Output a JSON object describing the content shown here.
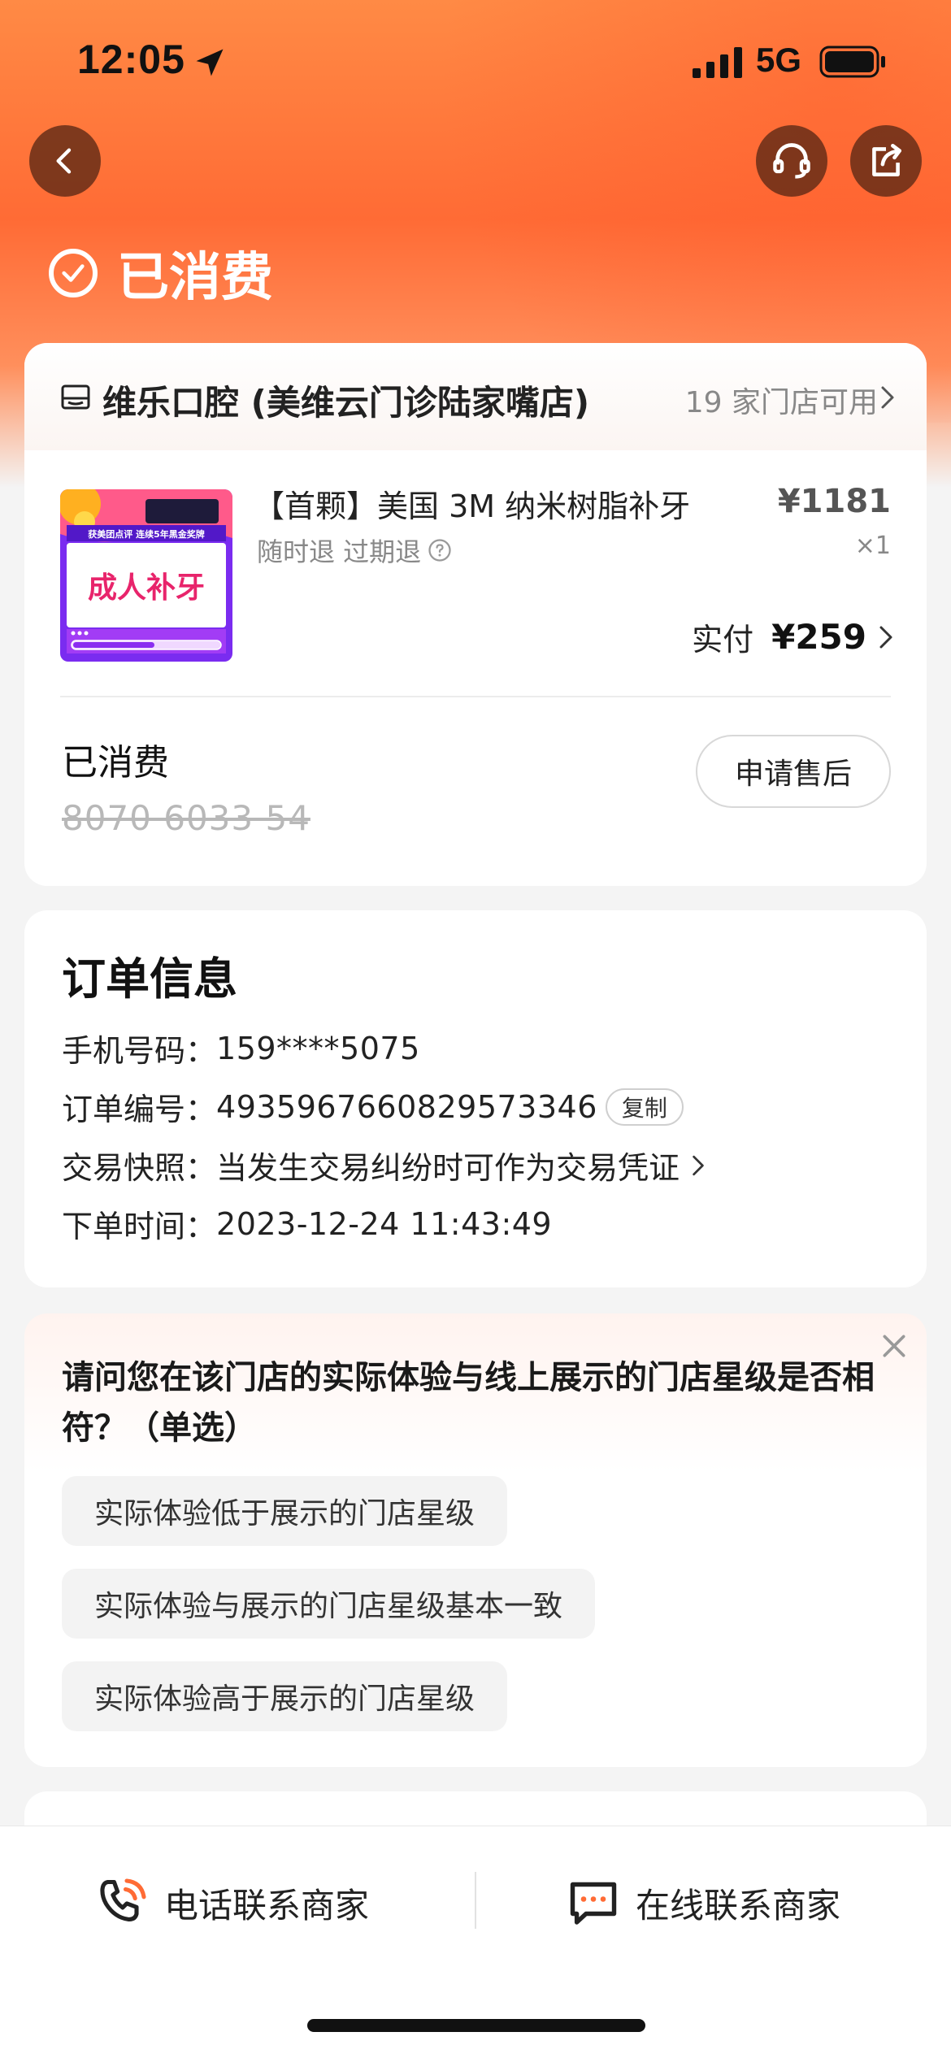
{
  "status_bar": {
    "time": "12:05",
    "network": "5G"
  },
  "header": {
    "order_status": "已消费"
  },
  "store": {
    "name": "维乐口腔 (美维云门诊陆家嘴店)",
    "available_count": "19 家门店可用"
  },
  "product": {
    "thumb_banner": "获美团点评 连续5年黑金奖牌",
    "thumb_title": "成人补牙",
    "title": "【首颗】美国 3M 纳米树脂补牙",
    "tags": "随时退 过期退",
    "price": "¥1181",
    "quantity": "×1",
    "paid_label": "实付",
    "paid_amount": "¥259"
  },
  "voucher": {
    "status": "已消费",
    "code": "8070 6033 54",
    "aftersale_label": "申请售后"
  },
  "order_info": {
    "title": "订单信息",
    "phone_label": "手机号码：",
    "phone": "159****5075",
    "order_no_label": "订单编号：",
    "order_no": "4935967660829573346",
    "copy_label": "复制",
    "snapshot_label": "交易快照：",
    "snapshot_desc": "当发生交易纠纷时可作为交易凭证",
    "time_label": "下单时间：",
    "time": "2023-12-24 11:43:49"
  },
  "survey": {
    "question": "请问您在该门店的实际体验与线上展示的门店星级是否相符？（单选）",
    "options": [
      "实际体验低于展示的门店星级",
      "实际体验与展示的门店星级基本一致",
      "实际体验高于展示的门店星级"
    ]
  },
  "bottom_bar": {
    "phone_contact": "电话联系商家",
    "online_contact": "在线联系商家"
  },
  "colors": {
    "accent_orange": "#ff6b35",
    "thumb_purple": "#7a2cf0",
    "thumb_pink": "#e8246b"
  }
}
